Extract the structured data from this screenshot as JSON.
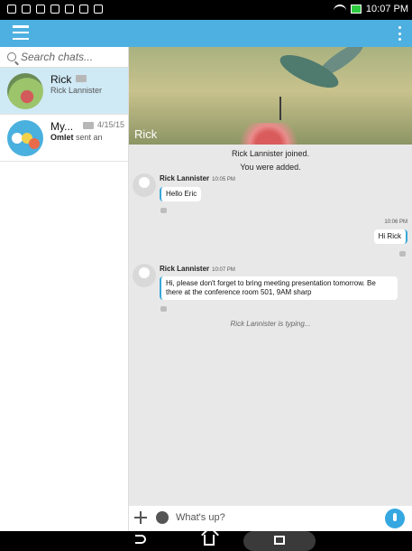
{
  "status_bar": {
    "time": "10:07 PM"
  },
  "search": {
    "placeholder": "Search chats..."
  },
  "chats": [
    {
      "name": "Rick",
      "time": "",
      "subtitle": "Rick Lannister"
    },
    {
      "name": "My...",
      "time": "4/15/15",
      "sender": "Omlet",
      "subtitle_rest": "sent an"
    }
  ],
  "conversation": {
    "title": "Rick",
    "system_messages": [
      "Rick Lannister joined.",
      "You were added."
    ],
    "messages": [
      {
        "sender": "Rick Lannister",
        "time": "10:05 PM",
        "text": "Hello Eric"
      },
      {
        "sender": "me",
        "time": "10:06 PM",
        "text": "Hi Rick"
      },
      {
        "sender": "Rick Lannister",
        "time": "10:07 PM",
        "text": "Hi, please don't forget to bring meeting presentation tomorrow. Be there at the conference room 501, 9AM sharp"
      }
    ],
    "typing": "Rick Lannister is typing..."
  },
  "compose": {
    "placeholder": "What's up?"
  },
  "colors": {
    "app_bar": "#4eb0e1",
    "accent": "#39a7d8"
  }
}
